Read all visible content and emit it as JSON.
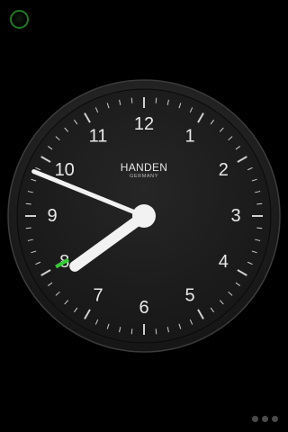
{
  "clock": {
    "brand": "HANDEN",
    "brand_subtitle": "GERMANY",
    "numerals": [
      "12",
      "1",
      "2",
      "3",
      "4",
      "5",
      "6",
      "7",
      "8",
      "9",
      "10",
      "11"
    ],
    "time": {
      "hour": 7,
      "minute": 48,
      "second": 40
    },
    "colors": {
      "face": "#1a1a1a",
      "bezel": "#2b2b2b",
      "hands": "#f2f2f2",
      "second_hand": "#33cc33"
    }
  },
  "status_indicator": {
    "icon": "status-ring-icon",
    "color": "#1f7a1f"
  },
  "pager": {
    "page_count": 3
  }
}
